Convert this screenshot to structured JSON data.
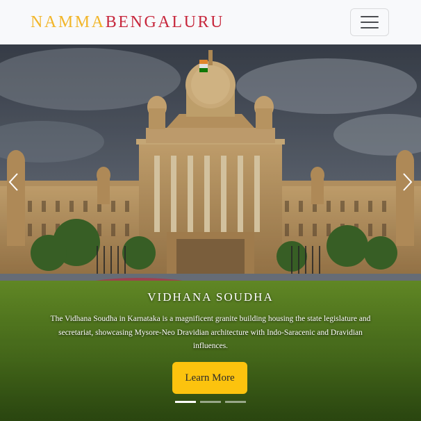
{
  "brand": {
    "part1": "NAMMA",
    "part2": "BENGALURU"
  },
  "navbar": {
    "toggler_icon": "hamburger-icon"
  },
  "carousel": {
    "prev_icon": "chevron-left-icon",
    "next_icon": "chevron-right-icon",
    "active_slide": 1,
    "slide_count": 3,
    "slide": {
      "title": "VIDHANA SOUDHA",
      "description": "The Vidhana Soudha in Karnataka is a magnificent granite building housing the state legislature and secretariat, showcasing Mysore-Neo Dravidian architecture with Indo-Saracenic and Dravidian influences.",
      "button_label": "Learn More"
    }
  },
  "colors": {
    "brand_part1": "#f2b62a",
    "brand_part2": "#c7283d",
    "button_bg": "#fcc30e",
    "navbar_bg": "#f8f9fb"
  }
}
